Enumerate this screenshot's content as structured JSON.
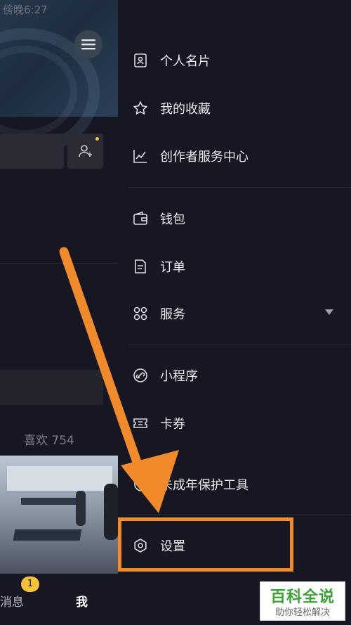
{
  "status_bar": {
    "time": "傍晚6:27",
    "icons": "··· ⏰ ▮ ≋ ▭"
  },
  "left_panel": {
    "likes_label": "喜欢 754",
    "tab_message": "消息",
    "tab_me": "我",
    "message_badge": "1"
  },
  "drawer": {
    "items": [
      {
        "label": "个人名片"
      },
      {
        "label": "我的收藏"
      },
      {
        "label": "创作者服务中心"
      },
      {
        "label": "钱包"
      },
      {
        "label": "订单"
      },
      {
        "label": "服务"
      },
      {
        "label": "小程序"
      },
      {
        "label": "卡券"
      },
      {
        "label": "未成年保护工具"
      },
      {
        "label": "设置"
      }
    ]
  },
  "watermark": {
    "title": "百科全说",
    "subtitle": "助你轻松解决"
  },
  "colors": {
    "background": "#161722",
    "accent_orange": "#f08a2a",
    "badge_yellow": "#f5c33b",
    "text": "#e9eaee"
  }
}
